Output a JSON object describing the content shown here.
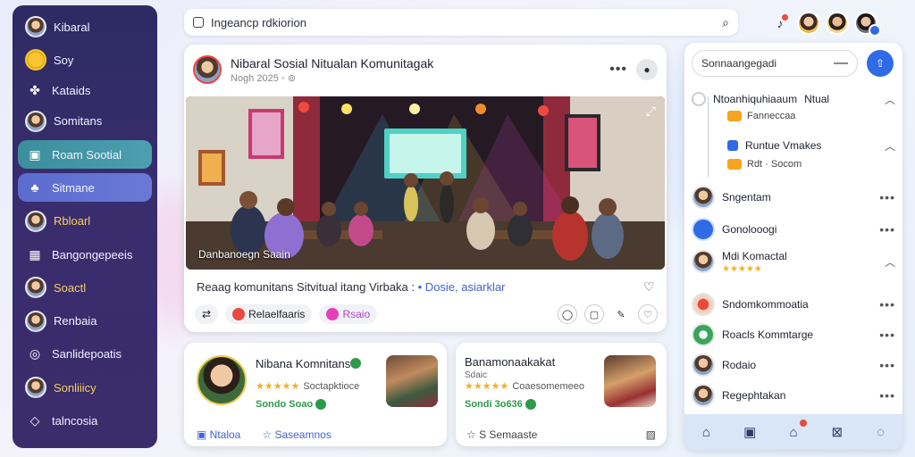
{
  "sidebar": {
    "title": "Kibaral",
    "items": [
      {
        "label": "Soy",
        "icon": "coin-icon"
      },
      {
        "label": "Kataids",
        "icon": "tree-icon"
      },
      {
        "label": "Somitans",
        "icon": "user-icon"
      },
      {
        "label": "Roam Sootial",
        "icon": "group-icon",
        "active": true
      },
      {
        "label": "Sitmane",
        "icon": "people-icon"
      },
      {
        "label": "Rbloarl",
        "icon": "user-icon"
      },
      {
        "label": "Bangongepeeis",
        "icon": "calendar-icon"
      },
      {
        "label": "Soactl",
        "icon": "user-icon"
      },
      {
        "label": "Renbaia",
        "icon": "user-icon"
      },
      {
        "label": "Sanlidepoatis",
        "icon": "camera-icon"
      },
      {
        "label": "Sonliiicy",
        "icon": "user-icon"
      },
      {
        "label": "talncosia",
        "icon": "location-icon"
      }
    ]
  },
  "search": {
    "value": "Ingeancp rdkiorion"
  },
  "post": {
    "title": "Nibaral Sosial Nitualan Komunitagak",
    "meta": "Nogh 2025 ◦ ⊚",
    "image_caption": "Danbanoegn Saain",
    "text": "Reaag komunitans Sitvitual itang Virbaka :",
    "text_link": "• Dosie, asiarklar",
    "reactions": [
      {
        "label": "Relaelfaaris"
      },
      {
        "label": "Rsaio"
      }
    ]
  },
  "cards": [
    {
      "name": "Nibana Komnitans",
      "stars": "★★★★★",
      "rating_label": "Soctapktioce",
      "green": "Sondo Soao",
      "footer_a": "Ntaloa",
      "footer_b": "Saseamnos"
    },
    {
      "name": "Banamonaakakat",
      "sub": "Sdaic",
      "stars": "★★★★★",
      "rating_label": "Coaesomemeeo",
      "green": "Sondi 3o636",
      "footer_a": "S Semaaste"
    }
  ],
  "right_panel": {
    "search_value": "Sonnaangegadi",
    "threads": [
      {
        "name": "Ntoanhiquhiaaum",
        "highlight": "Ntual",
        "sub": "Fanneccaa"
      },
      {
        "name": "Runtue Vmakes",
        "sub": "Rdt · Socom"
      }
    ],
    "contacts": [
      {
        "name": "Sngentam"
      },
      {
        "name": "Gonolooogi"
      },
      {
        "name": "Mdi Komactal",
        "stars": "★★★★★"
      },
      {
        "name": "Sndomkommoatia"
      },
      {
        "name": "Roacls Kommtarge"
      },
      {
        "name": "Rodaio"
      },
      {
        "name": "Regephtakan"
      }
    ]
  },
  "colors": {
    "sidebar_bg": "#2d2b63",
    "active_item": "#3b8e9c",
    "accent_blue": "#2f6be6",
    "green": "#2c9a48",
    "star": "#f2b01e"
  }
}
